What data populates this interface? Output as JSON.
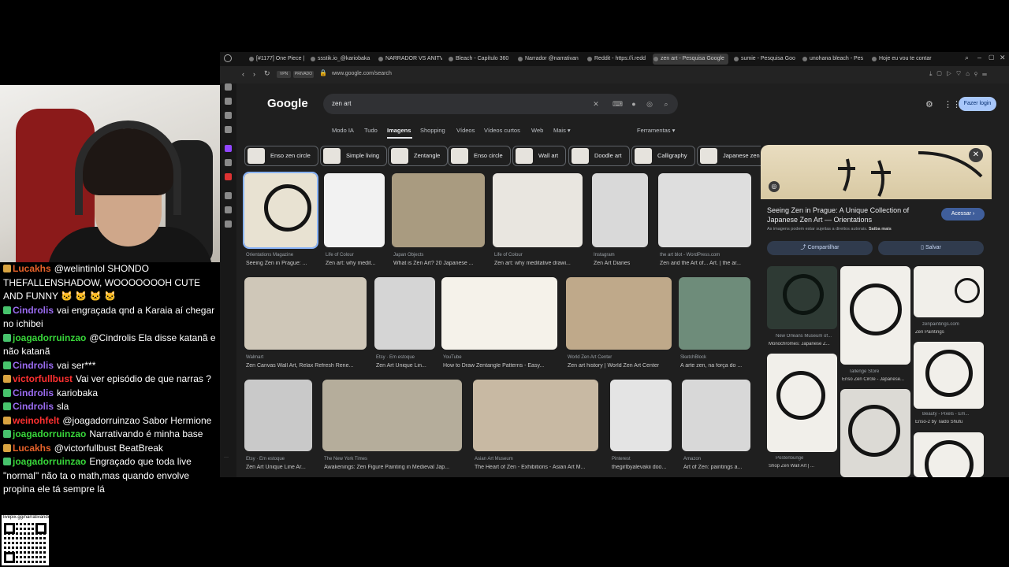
{
  "chat": {
    "messages": [
      {
        "user": "Lucakhs",
        "color": "#e8622a",
        "text": "@welintinlol SHONDO THEFALLENSHADOW, WOOOOOOOH CUTE AND FUNNY 🐱 🐱 🐱 🐱"
      },
      {
        "user": "Cindrolis",
        "color": "#9b6cf2",
        "text": "vai engraçada qnd a Karaia aí chegar no ichibei"
      },
      {
        "user": "joagadorruinzao",
        "color": "#38d63a",
        "text": "@Cindrolis Ela disse katanã e não katanã"
      },
      {
        "user": "Cindrolis",
        "color": "#9b6cf2",
        "text": "vai ser***"
      },
      {
        "user": "victorfullbust",
        "color": "#ff3030",
        "text": "Vai ver episódio de que narras ?"
      },
      {
        "user": "Cindrolis",
        "color": "#9b6cf2",
        "text": "kariobaka"
      },
      {
        "user": "Cindrolis",
        "color": "#9b6cf2",
        "text": "sla"
      },
      {
        "user": "weinohfelt",
        "color": "#ff3030",
        "text": "@joagadorruinzao Sabor Hermione"
      },
      {
        "user": "joagadorruinzao",
        "color": "#38d63a",
        "text": "Narrativando é minha base"
      },
      {
        "user": "Lucakhs",
        "color": "#e8622a",
        "text": "@victorfullbust BeatBreak"
      },
      {
        "user": "joagadorruinzao",
        "color": "#38d63a",
        "text": "Engraçado que toda live \"normal\" não ta o math,mas quando envolve propina ele tá sempre lá"
      }
    ],
    "qr_text": "livepix.gg/narrativando"
  },
  "browser": {
    "tabs": [
      {
        "label": "[#1177] One Piece | M"
      },
      {
        "label": "ssstik.io_@kariobaka"
      },
      {
        "label": "NARRADOR VS ANITV"
      },
      {
        "label": "Bleach - Capítulo 360"
      },
      {
        "label": "Narrador @narrativan"
      },
      {
        "label": "Reddit - https://i.redd"
      },
      {
        "label": "zen art - Pesquisa Google"
      },
      {
        "label": "sumie - Pesquisa Goo"
      },
      {
        "label": "unohana bleach - Pes"
      },
      {
        "label": "Hoje eu vou te contar"
      }
    ],
    "url": "www.google.com/search",
    "vpn": "VPN",
    "private": "PRIVADO"
  },
  "google": {
    "logo": "Google",
    "query": "zen art",
    "login": "Fazer login",
    "nav": [
      "Modo IA",
      "Tudo",
      "Imagens",
      "Shopping",
      "Vídeos",
      "Vídeos curtos",
      "Web",
      "Mais ▾"
    ],
    "tools": "Ferramentas ▾",
    "chips": [
      "Enso zen circle",
      "Simple living",
      "Zentangle",
      "Enso circle",
      "Wall art",
      "Doodle art",
      "Calligraphy",
      "Japanese zen"
    ],
    "row1": [
      {
        "src": "Orientations Magazine",
        "title": "Seeing Zen in Prague: ..."
      },
      {
        "src": "Life of Colour",
        "title": "Zen art: why medit..."
      },
      {
        "src": "Japan Objects",
        "title": "What is Zen Art? 20 Japanese ..."
      },
      {
        "src": "Life of Colour",
        "title": "Zen art: why meditative drawi..."
      },
      {
        "src": "Instagram",
        "title": "Zen Art Diaries"
      },
      {
        "src": "the art blot - WordPress.com",
        "title": "Zen and the Art of... Art. | the ar..."
      }
    ],
    "row2": [
      {
        "src": "Walmart",
        "title": "Zen Canvas Wall Art, Relax Refresh Rene..."
      },
      {
        "src": "Etsy · Em estoque",
        "title": "Zen Art Unique Lin..."
      },
      {
        "src": "YouTube",
        "title": "How to Draw Zentangle Patterns - Easy..."
      },
      {
        "src": "World Zen Art Center",
        "title": "Zen art history | World Zen Art Center"
      },
      {
        "src": "SketchBlock",
        "title": "A arte zen, na força do ..."
      }
    ],
    "row3": [
      {
        "src": "Etsy · Em estoque",
        "title": "Zen Art Unique Line Ar..."
      },
      {
        "src": "The New York Times",
        "title": "Awakenings: Zen Figure Painting in Medieval Jap..."
      },
      {
        "src": "Asian Art Museum",
        "title": "The Heart of Zen - Exhibitions - Asian Art M..."
      },
      {
        "src": "Pinterest",
        "title": "thegirlbyalevakii doo..."
      },
      {
        "src": "Amazon",
        "title": "Art of Zen: paintings a..."
      }
    ],
    "panel": {
      "title": "Seeing Zen in Prague: A Unique Collection of Japanese Zen Art — Orientations",
      "note": "As imagens podem estar sujeitas a direitos autorais.",
      "more": "Saiba mais",
      "visit": "Acessar ›",
      "share": "Compartilhar",
      "save": "Salvar",
      "related": [
        {
          "src": "New Orleans Museum of...",
          "title": "Monochromes: Japanese Z..."
        },
        {
          "src": "Tallenge Store",
          "title": "Enso Zen Circle - Japanese..."
        },
        {
          "src": "zenpaintings.com",
          "title": "Zen Paintings"
        },
        {
          "src": "Beauty - Pixels - Em...",
          "title": "Enso-2 by Taido Shufu"
        },
        {
          "src": "Posterlounge",
          "title": "Shop Zen Wall Art | ..."
        }
      ]
    }
  }
}
